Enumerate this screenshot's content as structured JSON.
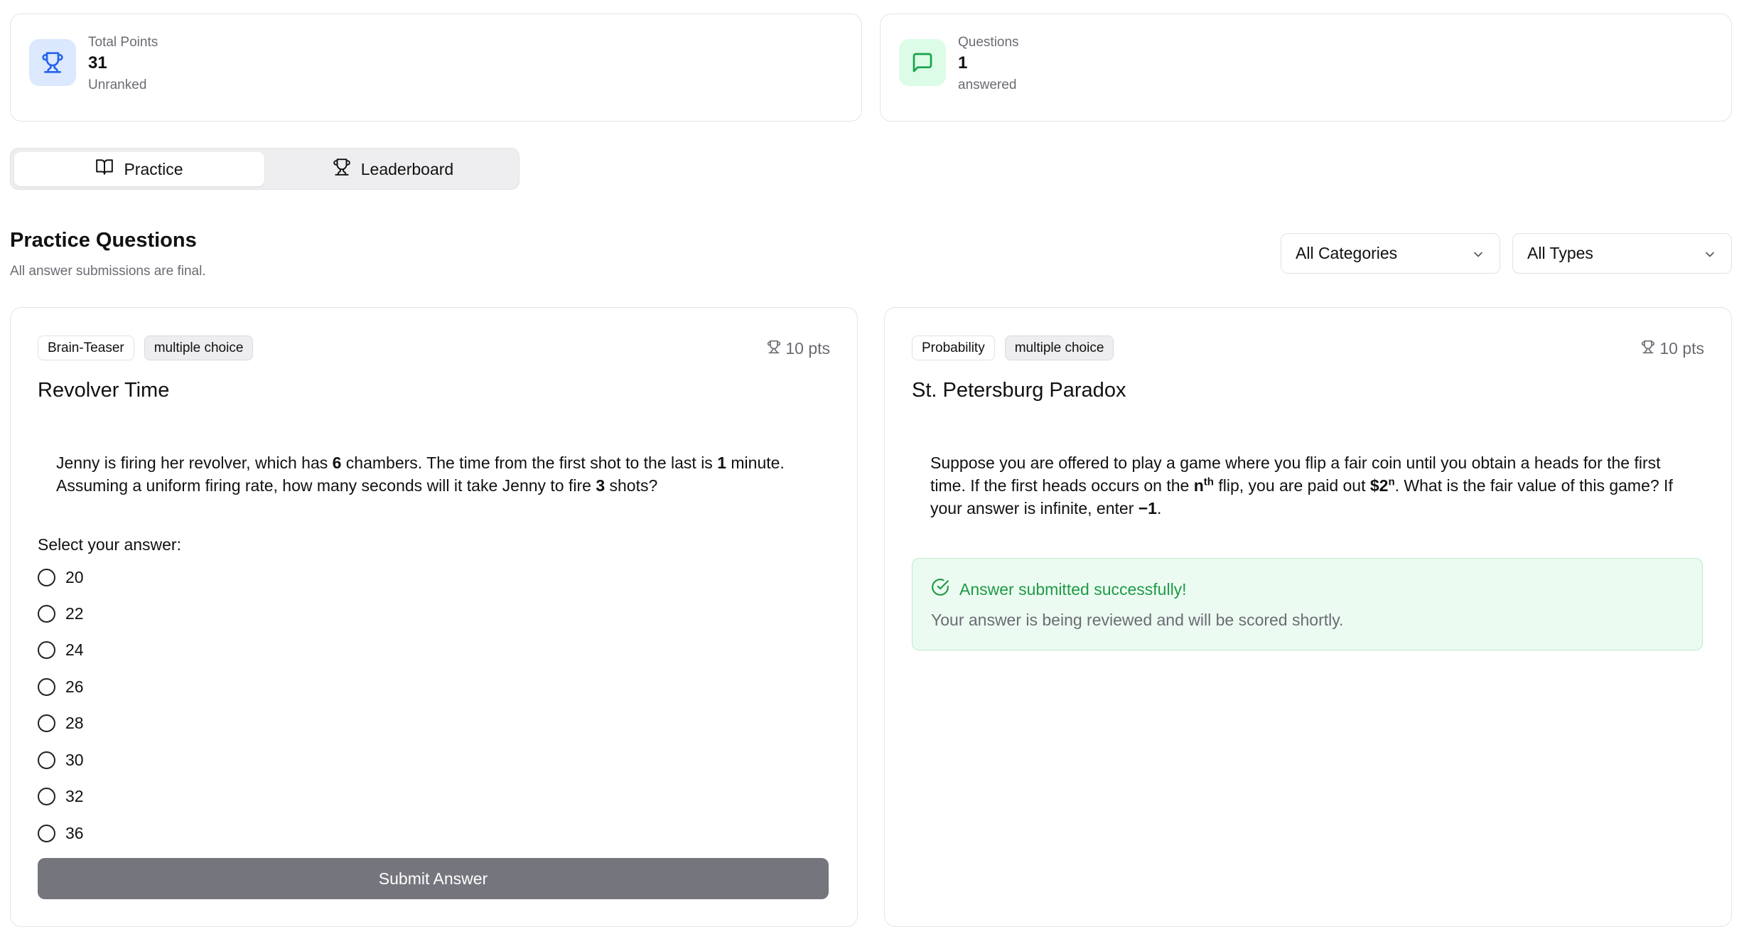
{
  "stats": {
    "points": {
      "label": "Total Points",
      "value": "31",
      "sub": "Unranked",
      "icon": "trophy-icon",
      "icon_bg": "#dbe8fe",
      "icon_color": "#2563eb"
    },
    "questions": {
      "label": "Questions",
      "value": "1",
      "sub": "answered",
      "icon": "message-icon",
      "icon_bg": "#dcfce7",
      "icon_color": "#16a34a"
    }
  },
  "tabs": [
    {
      "label": "Practice",
      "icon": "book-open-icon",
      "active": true
    },
    {
      "label": "Leaderboard",
      "icon": "trophy-icon",
      "active": false
    }
  ],
  "section": {
    "title": "Practice Questions",
    "subtitle": "All answer submissions are final."
  },
  "filters": {
    "category": "All Categories",
    "type": "All Types"
  },
  "questions": [
    {
      "category": "Brain-Teaser",
      "type": "multiple choice",
      "points": "10 pts",
      "title": "Revolver Time",
      "text": {
        "p1": "Jenny is firing her revolver, which has ",
        "b1": "6",
        "p2": " chambers. The time from the first shot to the last is ",
        "b2": "1",
        "p3": " minute. Assuming a uniform firing rate, how many seconds will it take Jenny to fire ",
        "b3": "3",
        "p4": " shots?"
      },
      "select_label": "Select your answer:",
      "options": [
        "20",
        "22",
        "24",
        "26",
        "28",
        "30",
        "32",
        "36"
      ],
      "submit_label": "Submit Answer",
      "submit_color": "#75757d"
    },
    {
      "category": "Probability",
      "type": "multiple choice",
      "points": "10 pts",
      "title": "St. Petersburg Paradox",
      "text": {
        "p1": "Suppose you are offered to play a game where you flip a fair coin until you obtain a heads for the first time. If the first heads occurs on the ",
        "b1": "n",
        "sup1": "th",
        "p2": " flip, you are paid out ",
        "b2": "$2",
        "sup2": "n",
        "p3": ". What is the fair value of this game? If your answer is infinite, enter ",
        "b3": "−1",
        "p4": "."
      },
      "status": {
        "title": "Answer submitted successfully!",
        "message": "Your answer is being reviewed and will be scored shortly.",
        "color": "#1f9a47"
      }
    }
  ]
}
